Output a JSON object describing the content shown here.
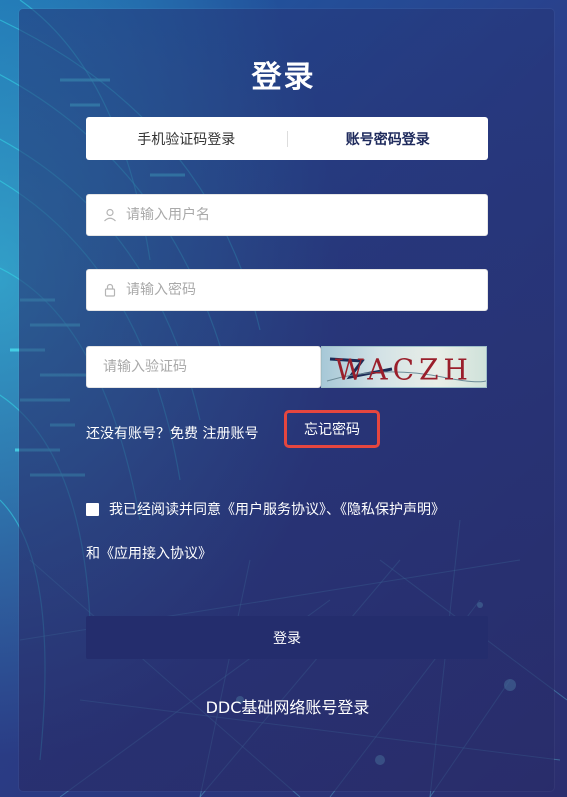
{
  "title": "登录",
  "tabs": [
    {
      "label": "手机验证码登录"
    },
    {
      "label": "账号密码登录"
    }
  ],
  "username": {
    "placeholder": "请输入用户名"
  },
  "password": {
    "placeholder": "请输入密码"
  },
  "captcha": {
    "placeholder": "请输入验证码",
    "image_text": "WACZH"
  },
  "links": {
    "no_account": "还没有账号？免费",
    "register": "注册账号",
    "forgot": "忘记密码"
  },
  "agreement": {
    "prefix": "我已经阅读并同意",
    "service": "《用户服务协议》",
    "sep": "、",
    "privacy": "《隐私保护声明》",
    "and": "和",
    "access": "《应用接入协议》"
  },
  "submit_label": "登录",
  "ddc_login": "DDC基础网络账号登录",
  "colors": {
    "forgot_highlight": "#e5463f",
    "submit_bg": "#242d6d",
    "network_lines": "#33d6e6"
  }
}
